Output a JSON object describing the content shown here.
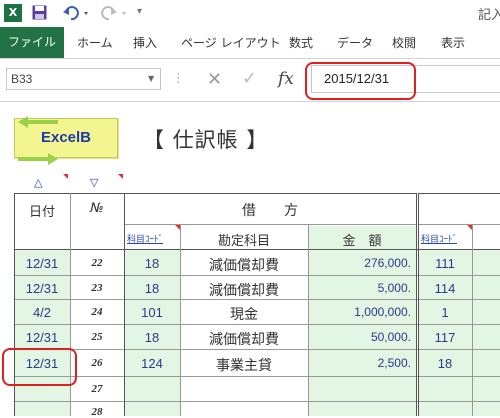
{
  "titlebar": {
    "app_icon": "excel-icon",
    "app_icon_text": "X",
    "doc_title": "記入"
  },
  "ribbon": {
    "tabs": [
      "ファイル",
      "ホーム",
      "挿入",
      "ページ レイアウト",
      "数式",
      "データ",
      "校閲",
      "表示"
    ]
  },
  "formula_bar": {
    "name_box": "B33",
    "fx": "fx",
    "value": "2015/12/31"
  },
  "sheet": {
    "button_label": "ExcelB",
    "title": "【 仕訳帳 】",
    "sort_date_icon": "△",
    "sort_no_icon": "▽",
    "header": {
      "date": "日付",
      "no": "№",
      "debit": "借　　方",
      "code": "科目ｺｰﾄﾞ",
      "account": "勘定科目",
      "amount": "金　額",
      "code2": "科目ｺｰﾄﾞ"
    },
    "rows": [
      {
        "date": "12/31",
        "no": "22",
        "code": "18",
        "account": "減価償却費",
        "amount": "276,000.",
        "code2": "111"
      },
      {
        "date": "12/31",
        "no": "23",
        "code": "18",
        "account": "減価償却費",
        "amount": "5,000.",
        "code2": "114"
      },
      {
        "date": "4/2",
        "no": "24",
        "code": "101",
        "account": "現金",
        "amount": "1,000,000.",
        "code2": "1"
      },
      {
        "date": "12/31",
        "no": "25",
        "code": "18",
        "account": "減価償却費",
        "amount": "50,000.",
        "code2": "117"
      },
      {
        "date": "12/31",
        "no": "26",
        "code": "124",
        "account": "事業主貸",
        "amount": "2,500.",
        "code2": "18"
      },
      {
        "date": "",
        "no": "27",
        "code": "",
        "account": "",
        "amount": "",
        "code2": ""
      },
      {
        "date": "",
        "no": "28",
        "code": "",
        "account": "",
        "amount": "",
        "code2": ""
      }
    ]
  },
  "colors": {
    "file_tab": "#217346",
    "highlight": "#e02020",
    "input_cell": "#e3f5e3",
    "button_bg": "#f2f590",
    "link_blue": "#2446b8"
  }
}
